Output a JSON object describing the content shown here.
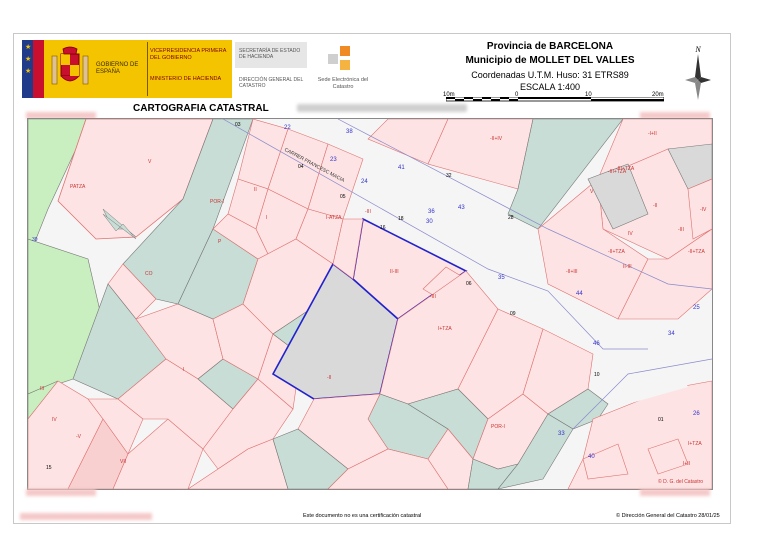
{
  "header": {
    "gobierno": "GOBIERNO DE ESPAÑA",
    "vicepresidencia": "VICEPRESIDENCIA PRIMERA DEL GOBIERNO",
    "ministerio": "MINISTERIO DE HACIENDA",
    "secretaria": "SECRETARÍA DE ESTADO DE HACIENDA",
    "direccion": "DIRECCIÓN GENERAL DEL CATASTRO",
    "sede": "Sede Electrónica del Catastro",
    "provincia": "Provincia de BARCELONA",
    "municipio": "Municipio de MOLLET DEL VALLES",
    "coordenadas": "Coordenadas U.T.M. Huso: 31 ETRS89",
    "escala": "ESCALA 1:400",
    "scale_labels": [
      "10m",
      "0",
      "10",
      "20m"
    ],
    "north": "N",
    "title": "CARTOGRAFIA CATASTRAL"
  },
  "map": {
    "street": "CARRER FRANCESC MACIA",
    "colors": {
      "private": "#fde3e3",
      "green": "#c7ddd5",
      "park": "#c9efc0",
      "road": "#f2f2f2",
      "selected": "#d9d9d9",
      "outline": "#e07070",
      "parcel": "#2222cc"
    },
    "parcel_numbers": [
      "03",
      "04",
      "05",
      "06",
      "09",
      "10",
      "01",
      "15",
      "32",
      "28",
      "16",
      "18"
    ],
    "portal_numbers": [
      "22",
      "23",
      "24",
      "41",
      "43",
      "30",
      "35",
      "44",
      "46",
      "38",
      "34",
      "25",
      "33",
      "40",
      "39",
      "26",
      "36"
    ],
    "labels": [
      "V",
      "PATZA",
      "POR-I",
      "II",
      "I",
      "I-ATZA",
      "-III",
      "II-III",
      "-III",
      "CO",
      "P",
      "I",
      "-II",
      "I+TZA",
      "POR-I",
      "III",
      "IV",
      "-V",
      "VII",
      "I+TZA",
      "II-III",
      "-II+TZA",
      "-III+TZA",
      "-I+II",
      "IV",
      "-III",
      "-II",
      "-IV",
      "V",
      "-II+TZA",
      "-II+III",
      "-II+IV",
      "-III+TZA",
      "I+II"
    ],
    "copyright": "© D. G. del Catastro"
  },
  "footer": {
    "disclaimer": "Este documento no es una certificación catastral",
    "copyright": "© Dirección General del Catastro 28/01/25"
  }
}
